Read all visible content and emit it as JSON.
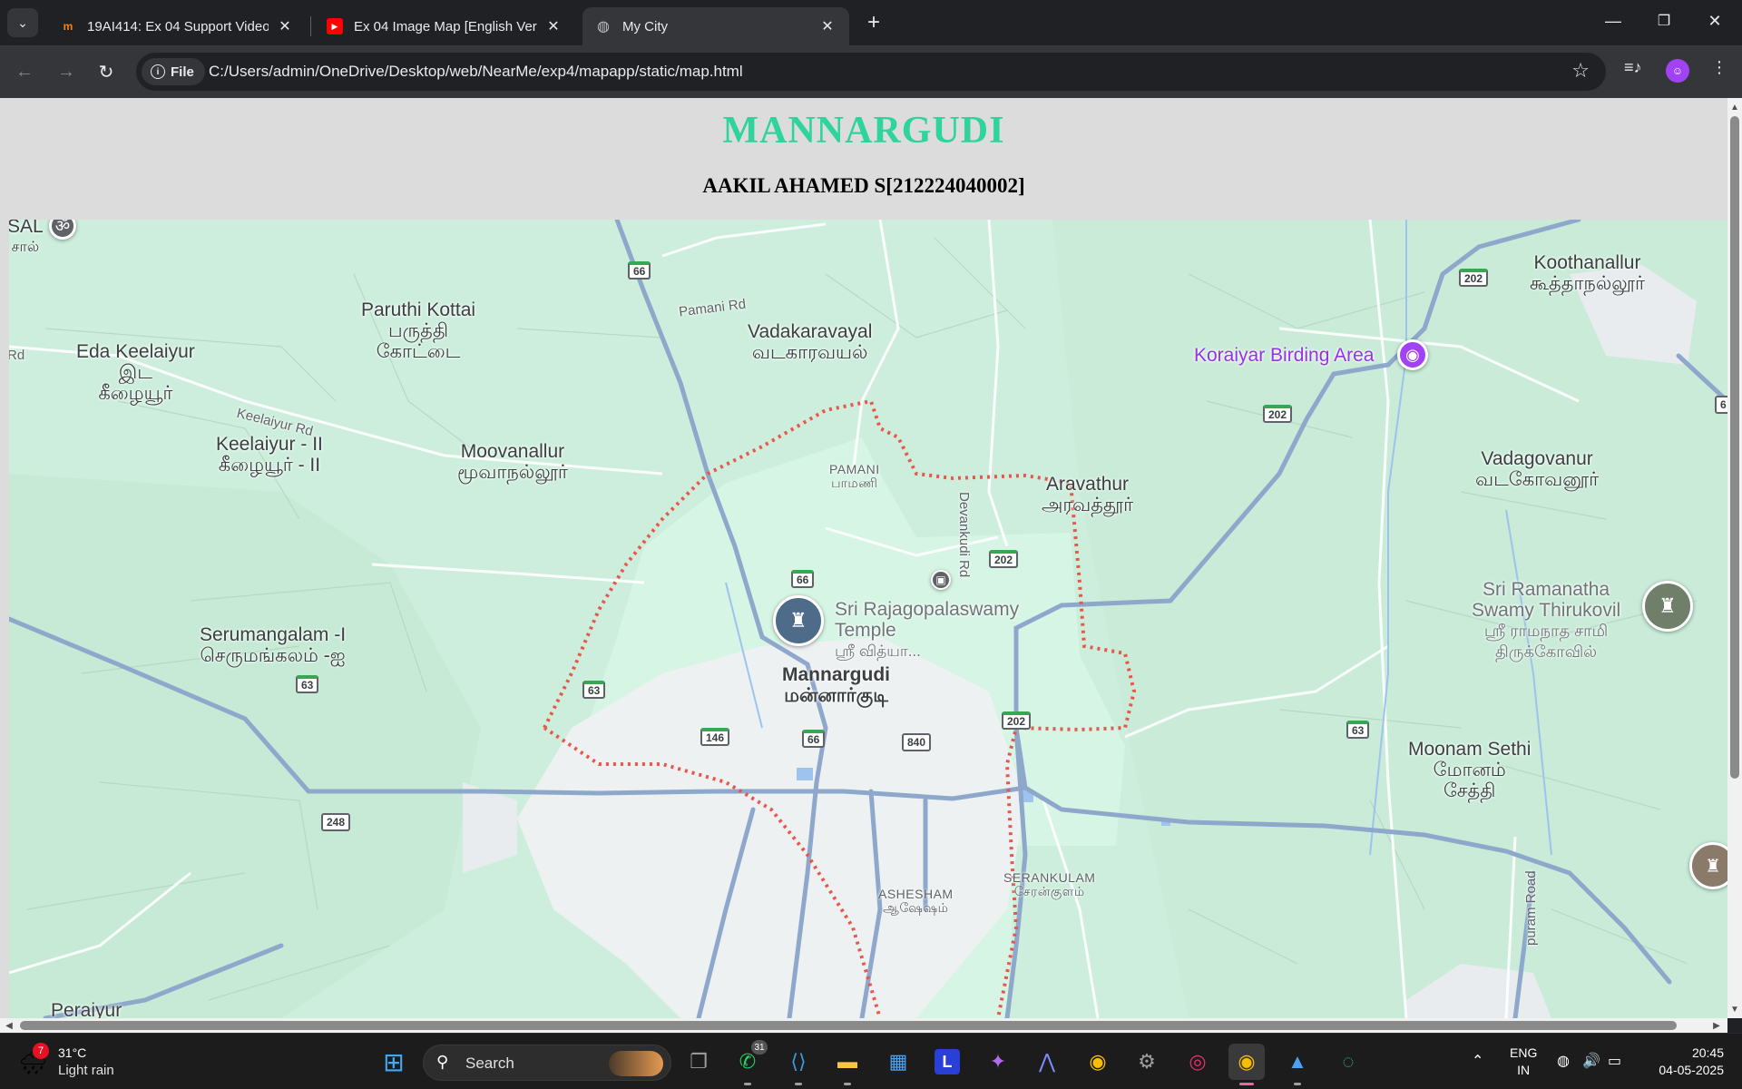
{
  "browser": {
    "tabs": [
      {
        "title": "19AI414: Ex 04 Support Video |",
        "favicon": "moodle-icon"
      },
      {
        "title": "Ex 04 Image Map [English Versi",
        "favicon": "youtube-icon"
      },
      {
        "title": "My City",
        "favicon": "globe-icon",
        "active": true
      }
    ],
    "address": {
      "chip": "File",
      "url": "C:/Users/admin/OneDrive/Desktop/web/NearMe/exp4/mapapp/static/map.html"
    }
  },
  "page": {
    "title": "MANNARGUDI",
    "subtitle": "AAKIL AHAMED S[212224040002]",
    "title_color": "#2fd39c"
  },
  "map": {
    "places": [
      {
        "en": "SAL",
        "ta": "சால்"
      },
      {
        "en": "Eda Keelaiyur",
        "ta": "இட",
        "ta2": "கீழையூர்"
      },
      {
        "en": "Paruthi Kottai",
        "ta": "பருத்தி",
        "ta2": "கோட்டை"
      },
      {
        "en": "Vadakaravayal",
        "ta": "வடகாரவயல்"
      },
      {
        "en": "Koothanallur",
        "ta": "கூத்தாநல்லூர்"
      },
      {
        "en": "Keelaiyur - II",
        "ta": "கீழையூர் - II"
      },
      {
        "en": "Moovanallur",
        "ta": "மூவாநல்லூர்"
      },
      {
        "en": "PAMANI",
        "ta": "பாமணி"
      },
      {
        "en": "Aravathur",
        "ta": "அரவத்தூர்"
      },
      {
        "en": "Vadagovanur",
        "ta": "வடகோவனூர்"
      },
      {
        "en": "Serumangalam -I",
        "ta": "செருமங்கலம் -ஐ"
      },
      {
        "en": "Mannargudi",
        "ta": "மன்னார்குடி"
      },
      {
        "en": "Moonam Sethi",
        "ta": "மோனம்",
        "ta2": "சேத்தி"
      },
      {
        "en": "ASHESHAM",
        "ta": "ஆஷேஷம்"
      },
      {
        "en": "SERANKULAM",
        "ta": "சேரன்குளம்"
      },
      {
        "en": "Peraiyur"
      }
    ],
    "pois": [
      {
        "name": "Koraiyar Birding Area",
        "icon": "camera-icon"
      },
      {
        "name": "Sri Rajagopalaswamy",
        "name2": "Temple",
        "ta": "ஸ்ரீ வித்யா...",
        "icon": "temple-icon"
      },
      {
        "name": "Sri Ramanatha",
        "name2": "Swamy Thirukovil",
        "ta": "ஸ்ரீ ராமநாத சாமி",
        "ta2": "திருக்கோவில்",
        "icon": "temple-icon"
      }
    ],
    "roads": [
      "Pamani Rd",
      "Keelaiyur Rd",
      "Devankudi Rd",
      "puram Road",
      "Rd"
    ],
    "shields": [
      "66",
      "202",
      "202",
      "66",
      "202",
      "63",
      "63",
      "146",
      "66",
      "840",
      "202",
      "63",
      "248",
      "6"
    ],
    "colors": {
      "land": "#cfeedd",
      "urban": "#f1f3f4",
      "highway": "#8ea8cc",
      "boundary": "#e8574b",
      "water": "#9dc3ef"
    }
  },
  "taskbar": {
    "weather": {
      "temp": "31°C",
      "condition": "Light rain",
      "badge": "7"
    },
    "search": "Search",
    "whatsapp_badge": "31",
    "language": {
      "line1": "ENG",
      "line2": "IN"
    },
    "clock": {
      "time": "20:45",
      "date": "04-05-2025"
    }
  }
}
